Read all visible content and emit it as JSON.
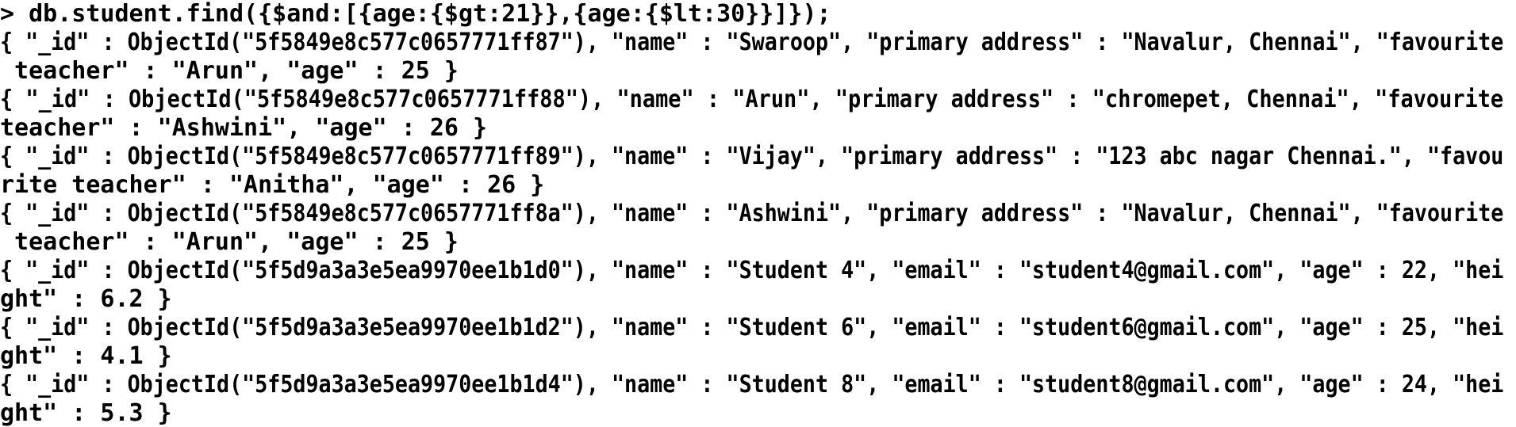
{
  "console": {
    "lines": [
      "> db.student.find({$and:[{age:{$gt:21}},{age:{$lt:30}}]});",
      "{ \"_id\" : ObjectId(\"5f5849e8c577c0657771ff87\"), \"name\" : \"Swaroop\", \"primary address\" : \"Navalur, Chennai\", \"favourite",
      " teacher\" : \"Arun\", \"age\" : 25 }",
      "{ \"_id\" : ObjectId(\"5f5849e8c577c0657771ff88\"), \"name\" : \"Arun\", \"primary address\" : \"chromepet, Chennai\", \"favourite",
      "teacher\" : \"Ashwini\", \"age\" : 26 }",
      "{ \"_id\" : ObjectId(\"5f5849e8c577c0657771ff89\"), \"name\" : \"Vijay\", \"primary address\" : \"123 abc nagar Chennai.\", \"favou",
      "rite teacher\" : \"Anitha\", \"age\" : 26 }",
      "{ \"_id\" : ObjectId(\"5f5849e8c577c0657771ff8a\"), \"name\" : \"Ashwini\", \"primary address\" : \"Navalur, Chennai\", \"favourite",
      " teacher\" : \"Arun\", \"age\" : 25 }",
      "{ \"_id\" : ObjectId(\"5f5d9a3a3e5ea9970ee1b1d0\"), \"name\" : \"Student 4\", \"email\" : \"student4@gmail.com\", \"age\" : 22, \"hei",
      "ght\" : 6.2 }",
      "{ \"_id\" : ObjectId(\"5f5d9a3a3e5ea9970ee1b1d2\"), \"name\" : \"Student 6\", \"email\" : \"student6@gmail.com\", \"age\" : 25, \"hei",
      "ght\" : 4.1 }",
      "{ \"_id\" : ObjectId(\"5f5d9a3a3e5ea9970ee1b1d4\"), \"name\" : \"Student 8\", \"email\" : \"student8@gmail.com\", \"age\" : 24, \"hei",
      "ght\" : 5.3 }"
    ]
  }
}
